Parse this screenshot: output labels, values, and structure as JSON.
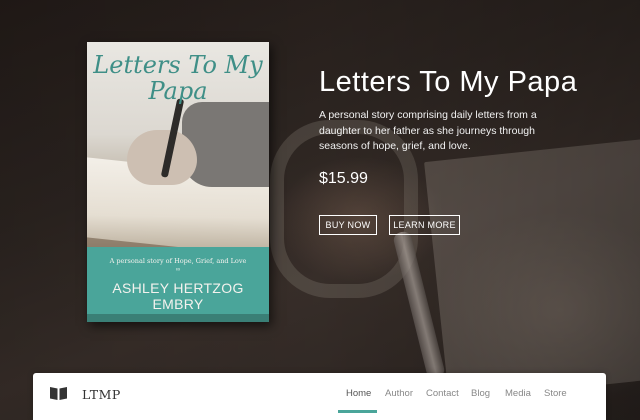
{
  "book": {
    "title": "Letters To My Papa",
    "cover_title_line1": "Letters To My",
    "cover_title_line2": "Papa",
    "cover_subtitle": "A personal story of Hope, Grief, and Love",
    "cover_divider": "∞",
    "cover_author": "ASHLEY HERTZOG EMBRY",
    "accent_color": "#4aa59a"
  },
  "hero": {
    "heading": "Letters To My Papa",
    "description": "A personal story comprising daily letters from a daughter to her father as she journeys through seasons of hope, grief, and love.",
    "price": "$15.99",
    "buy_label": "BUY NOW",
    "learn_label": "LEARN MORE"
  },
  "navbar": {
    "brand_icon": "open-book-icon",
    "brand": "LTMP",
    "items": [
      {
        "label": "Home",
        "active": true
      },
      {
        "label": "Author"
      },
      {
        "label": "Contact"
      },
      {
        "label": "Blog"
      },
      {
        "label": "Media"
      },
      {
        "label": "Store"
      }
    ]
  }
}
